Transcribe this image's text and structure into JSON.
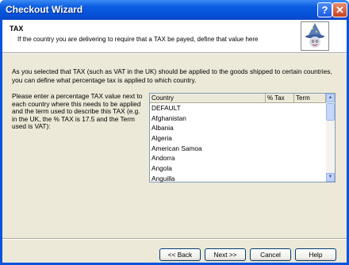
{
  "window": {
    "title": "Checkout Wizard"
  },
  "titlebar_buttons": {
    "help": "?",
    "close": "✕"
  },
  "header": {
    "title": "TAX",
    "description": "If the country you are delivering to require that a TAX be payed, define that value here"
  },
  "intro_text": "As you selected that TAX (such as VAT in the UK) should be applied to the goods shipped to certain countries, you can define what percentage tax is applied to which country.",
  "instructions": "Please enter a percentage TAX value next to each country where this needs to be applied and the term used to describe this TAX (e.g. in the UK, the % TAX is 17.5 and the Term used is VAT):",
  "grid": {
    "columns": [
      "Country",
      "% Tax",
      "Term"
    ],
    "rows": [
      "DEFAULT",
      "Afghanistan",
      "Albania",
      "Algeria",
      "American Samoa",
      "Andorra",
      "Angola",
      "Anguilla"
    ]
  },
  "scrollbar": {
    "up": "▲",
    "down": "▼"
  },
  "buttons": {
    "back": "<< Back",
    "next": "Next >>",
    "cancel": "Cancel",
    "help": "Help"
  }
}
